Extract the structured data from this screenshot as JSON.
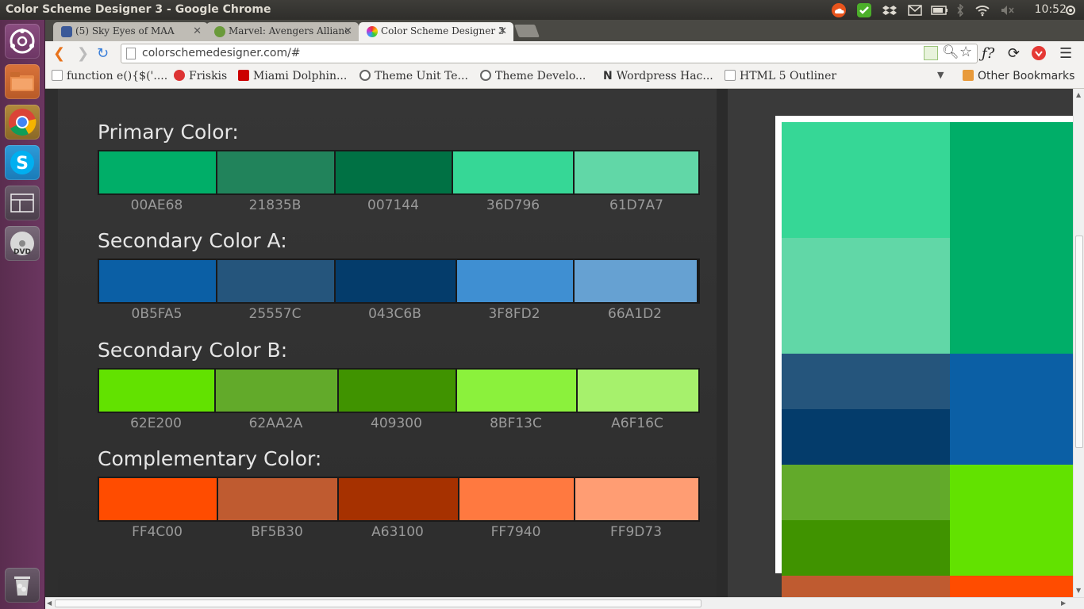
{
  "window": {
    "title": "Color Scheme Designer 3 - Google Chrome",
    "clock": "10:52"
  },
  "tabs": [
    {
      "label": "(5) Sky Eyes of MAA",
      "icon": "facebook-icon",
      "color": "#3b5998"
    },
    {
      "label": "Marvel: Avengers Allianc",
      "icon": "marvel-icon",
      "color": "#6a9a3a"
    },
    {
      "label": "Color Scheme Designer 3",
      "icon": "color-wheel-icon",
      "color": "#e04040"
    }
  ],
  "toolbar": {
    "url": "colorschemedesigner.com/#"
  },
  "bookmarks": [
    {
      "label": "function e(){$('....",
      "icon": "page-icon"
    },
    {
      "label": "Friskis",
      "icon": "friskis-icon"
    },
    {
      "label": "Miami Dolphin...",
      "icon": "youtube-icon"
    },
    {
      "label": "Theme Unit Te...",
      "icon": "wordpress-icon"
    },
    {
      "label": "Theme Develo...",
      "icon": "wordpress-icon"
    },
    {
      "label": "Wordpress Hac...",
      "icon": "n-icon"
    },
    {
      "label": "HTML 5 Outliner",
      "icon": "page-icon"
    }
  ],
  "other_bookmarks": "Other Bookmarks",
  "sections": [
    {
      "title": "Primary Color:",
      "colors": [
        "00AE68",
        "21835B",
        "007144",
        "36D796",
        "61D7A7"
      ]
    },
    {
      "title": "Secondary Color A:",
      "colors": [
        "0B5FA5",
        "25557C",
        "043C6B",
        "3F8FD2",
        "66A1D2"
      ]
    },
    {
      "title": "Secondary Color B:",
      "colors": [
        "62E200",
        "62AA2A",
        "409300",
        "8BF13C",
        "A6F16C"
      ]
    },
    {
      "title": "Complementary Color:",
      "colors": [
        "FF4C00",
        "BF5B30",
        "A63100",
        "FF7940",
        "FF9D73"
      ]
    }
  ],
  "preview": {
    "left_column": [
      "36D796",
      "61D7A7",
      "25557C",
      "043C6B",
      "62AA2A",
      "409300",
      "BF5B30"
    ],
    "right_column": [
      "00AE68",
      "0B5FA5",
      "62E200",
      "FF4C00"
    ]
  }
}
